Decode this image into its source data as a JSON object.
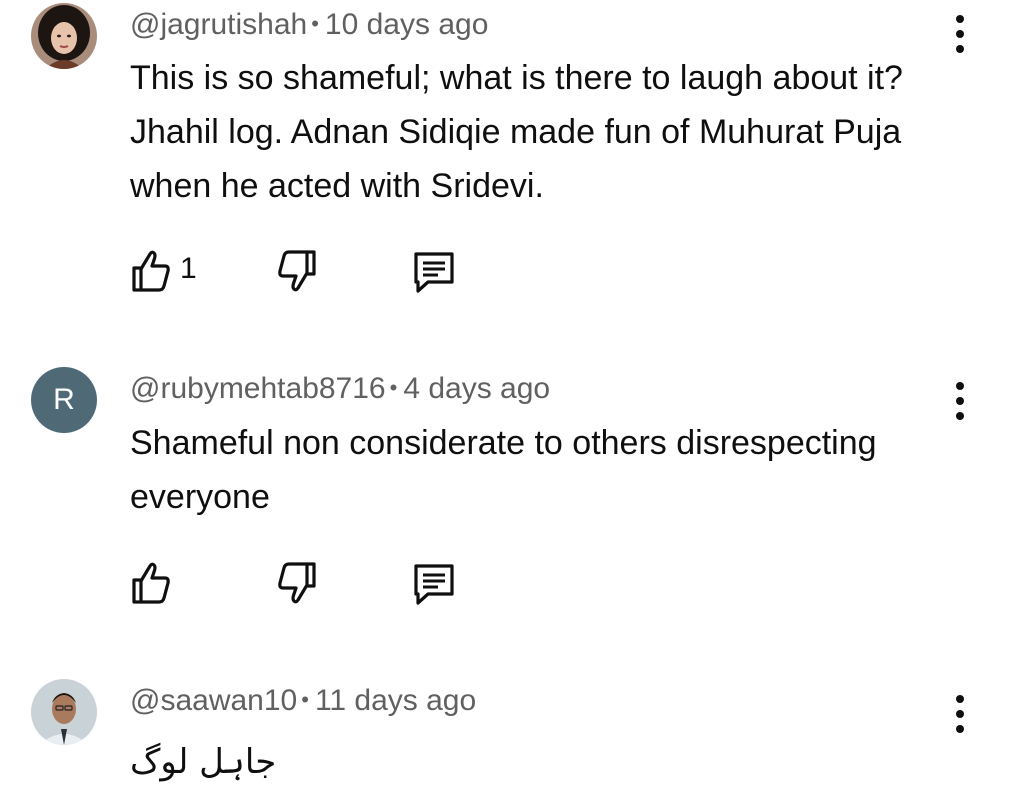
{
  "comments": [
    {
      "handle": "@jagrutishah",
      "age": "10 days ago",
      "text": "This is so shameful; what is there to laugh about it? Jhahil log. Adnan Sidiqie made fun of Muhurat Puja when he acted with Sridevi.",
      "likes": "1",
      "avatar_type": "photo"
    },
    {
      "handle": "@rubymehtab8716",
      "age": "4 days ago",
      "text": "Shameful non considerate to others disrespecting everyone",
      "likes": "",
      "avatar_letter": "R",
      "avatar_type": "letter"
    },
    {
      "handle": "@saawan10",
      "age": "11 days ago",
      "text": "جاہل لوگ",
      "likes": "",
      "avatar_type": "photo"
    }
  ],
  "separator": "•",
  "icons": [
    "like-icon",
    "dislike-icon",
    "reply-icon",
    "more-vert-icon"
  ],
  "colors": {
    "text": "#0f0f0f",
    "meta": "#606060",
    "letter_avatar_bg": "#4f6a76"
  }
}
